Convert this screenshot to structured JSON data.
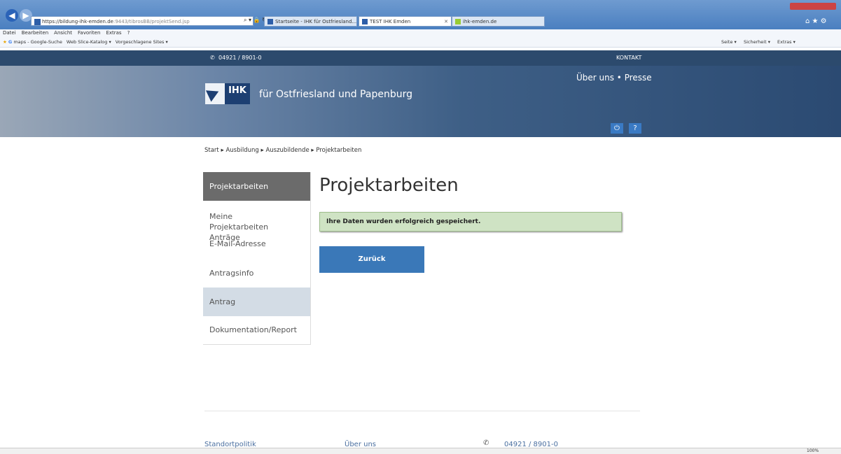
{
  "browser": {
    "url_host": "https://bildung-ihk-emden.de",
    "url_path": ":9443/tibrosBB/projektSend.jsp",
    "tabs": [
      "Startseite - IHK für Ostfriesland...",
      "TEST IHK Emden",
      "ihk-emden.de"
    ],
    "menu": [
      "Datei",
      "Bearbeiten",
      "Ansicht",
      "Favoriten",
      "Extras",
      "?"
    ],
    "favorites": [
      "maps - Google-Suche",
      "Web Slice-Katalog ▾",
      "Vorgeschlagene Sites ▾"
    ],
    "toolbar_right": [
      "Seite ▾",
      "Sicherheit ▾",
      "Extras ▾"
    ],
    "zoom": "100%"
  },
  "site": {
    "phone": "04921 / 8901-0",
    "contact": "KONTAKT",
    "topnav": "Über uns • Presse",
    "logo_text": "IHK",
    "org_name": "für Ostfriesland und Papenburg",
    "icons": [
      "power-icon",
      "help-icon"
    ],
    "help_glyph": "?"
  },
  "breadcrumb": [
    "Start",
    "Ausbildung",
    "Auszubildende",
    "Projektarbeiten"
  ],
  "sidebar": {
    "items": [
      {
        "label": "Projektarbeiten"
      },
      {
        "label": "Meine Projektarbeiten Anträge"
      },
      {
        "label": "E-Mail-Adresse"
      },
      {
        "label": "Antragsinfo"
      },
      {
        "label": "Antrag"
      },
      {
        "label": "Dokumentation/Report"
      }
    ]
  },
  "main": {
    "title": "Projektarbeiten",
    "alert": "Ihre Daten wurden erfolgreich gespeichert.",
    "back_button": "Zurück"
  },
  "footer": {
    "links": [
      "Standortpolitik",
      "Über uns"
    ],
    "phone": "04921 / 8901-0"
  },
  "colors": {
    "accent": "#3a78b8",
    "success_bg": "#cfe3c4",
    "sidebar_active": "#6b6b6b",
    "sidebar_selected": "#d3dce5"
  }
}
